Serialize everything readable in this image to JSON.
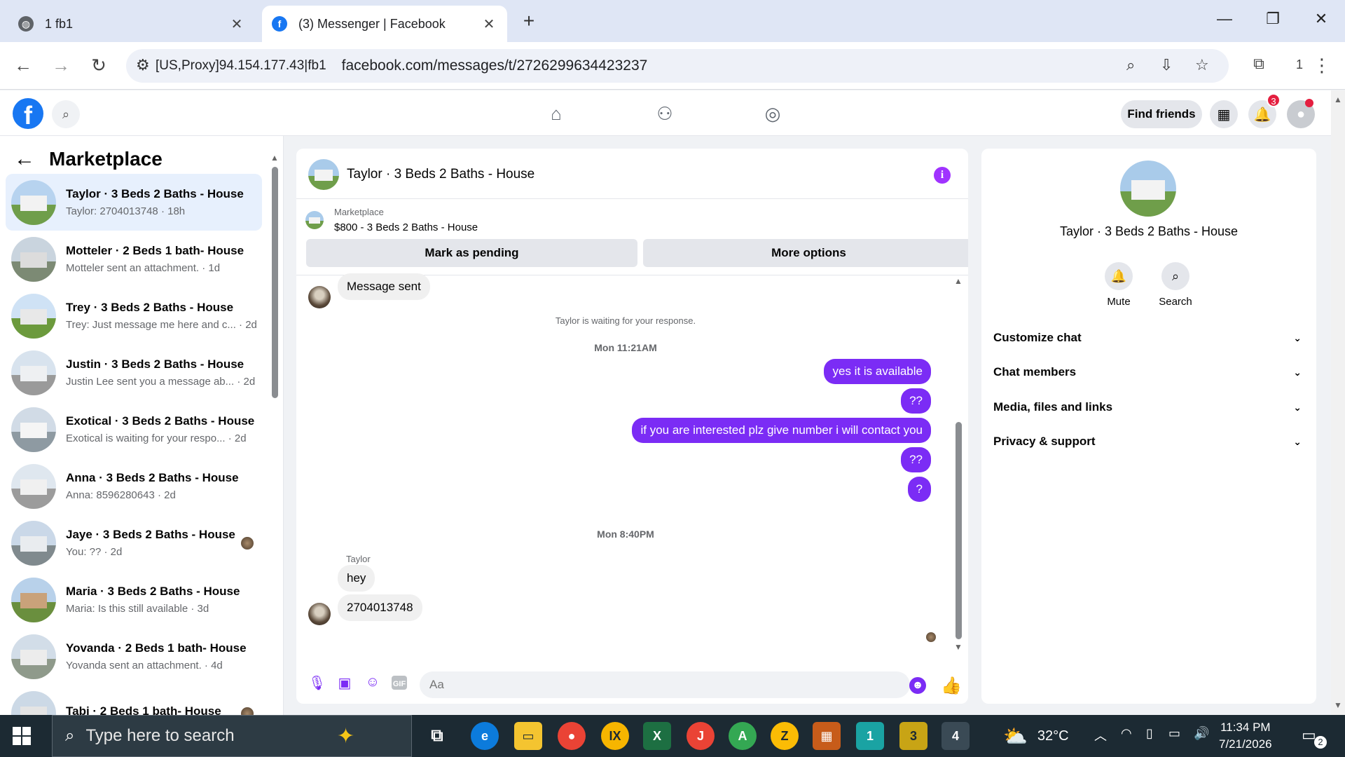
{
  "browser": {
    "tabs": [
      {
        "title": "1 fb1",
        "active": false
      },
      {
        "title": "(3) Messenger | Facebook",
        "active": true
      }
    ],
    "address": {
      "site_label": "[US,Proxy]94.154.177.43|fb1",
      "url": "facebook.com/messages/t/2726299634423237"
    },
    "extension_count": "1"
  },
  "fb_header": {
    "find_friends": "Find friends",
    "notification_count": "3",
    "colors": {
      "brand": "#1877f2",
      "badge": "#e41e3f"
    }
  },
  "sidebar": {
    "title": "Marketplace",
    "conversations": [
      {
        "title": "Taylor · 3 Beds 2 Baths - House",
        "preview": "Taylor: 2704013748 · 18h",
        "selected": true
      },
      {
        "title": "Motteler · 2 Beds 1 bath- House",
        "preview": "Motteler sent an attachment. · 1d"
      },
      {
        "title": "Trey · 3 Beds 2 Baths - House",
        "preview": "Trey: Just message me here and c... · 2d"
      },
      {
        "title": "Justin · 3 Beds 2 Baths - House",
        "preview": "Justin Lee sent you a message ab... · 2d"
      },
      {
        "title": "Exotical · 3 Beds 2 Baths - House",
        "preview": "Exotical is waiting for your respo... · 2d"
      },
      {
        "title": "Anna · 3 Beds 2 Baths - House",
        "preview": "Anna: 8596280643 · 2d"
      },
      {
        "title": "Jaye · 3 Beds 2 Baths - House",
        "preview": "You: ?? · 2d"
      },
      {
        "title": "Maria · 3 Beds 2 Baths - House",
        "preview": "Maria: Is this still available · 3d"
      },
      {
        "title": "Yovanda · 2 Beds 1 bath- House",
        "preview": "Yovanda sent an attachment. · 4d"
      },
      {
        "title": "Tabi · 2 Beds 1 bath- House",
        "preview": ""
      }
    ]
  },
  "chat": {
    "title": "Taylor · 3 Beds 2 Baths - House",
    "marketplace_label": "Marketplace",
    "listing": "$800 - 3 Beds 2 Baths - House",
    "mark_pending": "Mark as pending",
    "more_options": "More options",
    "message_sent": "Message sent",
    "waiting_notice": "Taylor is waiting for your response.",
    "timestamp_1": "Mon 11:21AM",
    "outgoing": [
      "yes it is available",
      "??",
      "if you are interested plz give number i will contact you",
      "??",
      "?"
    ],
    "timestamp_2": "Mon 8:40PM",
    "sender_name": "Taylor",
    "incoming": [
      "hey",
      "2704013748"
    ],
    "input_placeholder": "Aa",
    "colors": {
      "accent": "#7b2cf5",
      "incoming_bubble": "#f0f0f0"
    }
  },
  "details": {
    "name": "Taylor · 3 Beds 2 Baths - House",
    "actions": [
      "Mute",
      "Search"
    ],
    "sections": [
      "Customize chat",
      "Chat members",
      "Media, files and links",
      "Privacy & support"
    ]
  },
  "taskbar": {
    "search_placeholder": "Type here to search",
    "temperature": "32°C",
    "time": "11:34 PM",
    "date": "7/21/2026",
    "notification_count": "2",
    "app_badges": [
      "1",
      "3",
      "4"
    ]
  }
}
